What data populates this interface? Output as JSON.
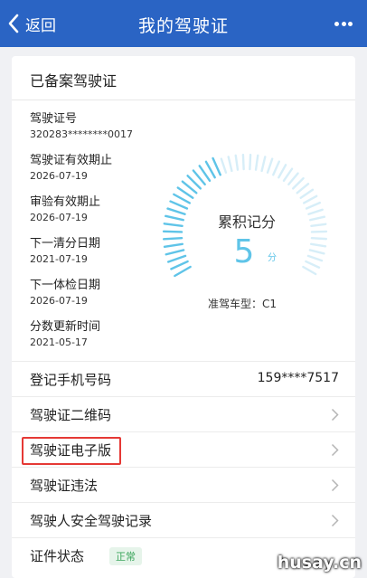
{
  "nav": {
    "back_label": "返回",
    "title": "我的驾驶证"
  },
  "card": {
    "title": "已备案驾驶证"
  },
  "info": [
    {
      "label": "驾驶证号",
      "value": "320283********0017"
    },
    {
      "label": "驾驶证有效期止",
      "value": "2026-07-19"
    },
    {
      "label": "审验有效期止",
      "value": "2026-07-19"
    },
    {
      "label": "下一清分日期",
      "value": "2021-07-19"
    },
    {
      "label": "下一体检日期",
      "value": "2026-07-19"
    },
    {
      "label": "分数更新时间",
      "value": "2021-05-17"
    }
  ],
  "gauge": {
    "label": "累积记分",
    "score": "5",
    "unit": "分",
    "max": 12,
    "car_type_label": "准驾车型：",
    "car_type": "C1",
    "accent": "#5fc4e8",
    "track": "#d7eef8"
  },
  "rows": [
    {
      "label": "登记手机号码",
      "value": "159****7517"
    },
    {
      "label": "驾驶证二维码"
    },
    {
      "label": "驾驶证电子版"
    },
    {
      "label": "驾驶证违法"
    },
    {
      "label": "驾驶人安全驾驶记录"
    },
    {
      "label": "证件状态",
      "badge": "正常"
    }
  ],
  "watermark": "husay.cn",
  "colors": {
    "nav": "#2a64c4",
    "highlight": "#e53935",
    "badge_text": "#3ba55c"
  }
}
